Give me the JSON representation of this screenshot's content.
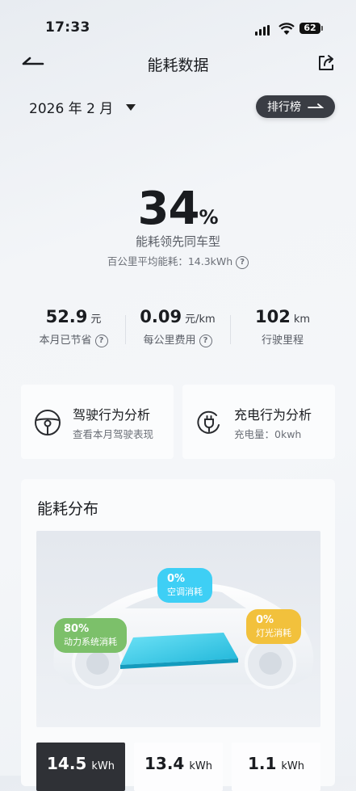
{
  "status": {
    "time": "17:33",
    "battery": "62"
  },
  "header": {
    "title": "能耗数据"
  },
  "period": {
    "label": "2026 年 2 月"
  },
  "ranking_button": "排行榜",
  "hero": {
    "percent": "34",
    "percent_unit": "%",
    "subtitle": "能耗领先同车型",
    "avg_label": "百公里平均能耗：14.3kWh"
  },
  "stats": [
    {
      "value": "52.9",
      "unit": "元",
      "label": "本月已节省",
      "help": true
    },
    {
      "value": "0.09",
      "unit": "元/km",
      "label": "每公里费用",
      "help": true
    },
    {
      "value": "102",
      "unit": "km",
      "label": "行驶里程",
      "help": false
    }
  ],
  "cards": {
    "driving": {
      "title": "驾驶行为分析",
      "subtitle": "查看本月驾驶表现"
    },
    "charging": {
      "title": "充电行为分析",
      "subtitle": "充电量：0kwh"
    }
  },
  "distribution": {
    "title": "能耗分布",
    "items": [
      {
        "percent": "0%",
        "label": "空调消耗",
        "color": "#3ecff5"
      },
      {
        "percent": "80%",
        "label": "动力系统消耗",
        "color": "#7cc06a"
      },
      {
        "percent": "0%",
        "label": "灯光消耗",
        "color": "#f2c13c"
      }
    ]
  },
  "bottom_values": [
    {
      "value": "14.5",
      "unit": "kWh"
    },
    {
      "value": "13.4",
      "unit": "kWh"
    },
    {
      "value": "1.1",
      "unit": "kWh"
    }
  ]
}
